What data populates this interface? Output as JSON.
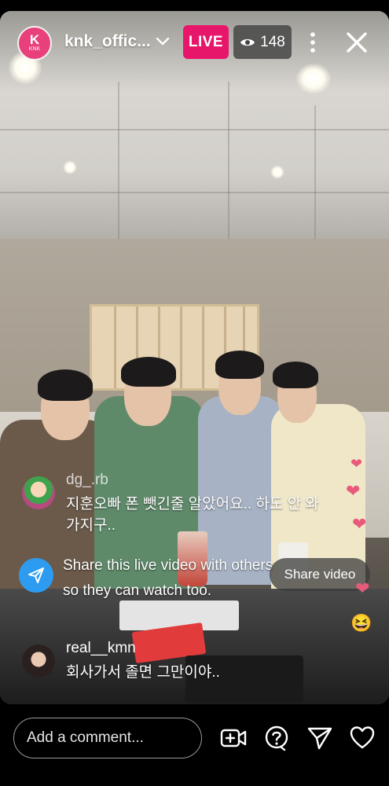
{
  "header": {
    "logo_text": "KNK",
    "logo_mark": "K",
    "username": "knk_offic...",
    "live_label": "LIVE",
    "viewer_count": "148"
  },
  "comments": [
    {
      "username": "dg_.rb",
      "text": "지훈오빠 폰 뺏긴줄 알았어요.. 하도 안 와가지구.."
    },
    {
      "username": "real__kmn",
      "text": "회사가서 졸면 그만이야.."
    }
  ],
  "share_prompt": {
    "text": "Share this live video with others so they can watch too."
  },
  "share_video_button": "Share video",
  "reactions": [
    "❤",
    "❤",
    "❤",
    "❤",
    "😆"
  ],
  "bottom_bar": {
    "comment_placeholder": "Add a comment..."
  },
  "colors": {
    "live_badge": "#e8166b",
    "share_icon": "#2d9cf0",
    "logo": "#e8407a"
  }
}
